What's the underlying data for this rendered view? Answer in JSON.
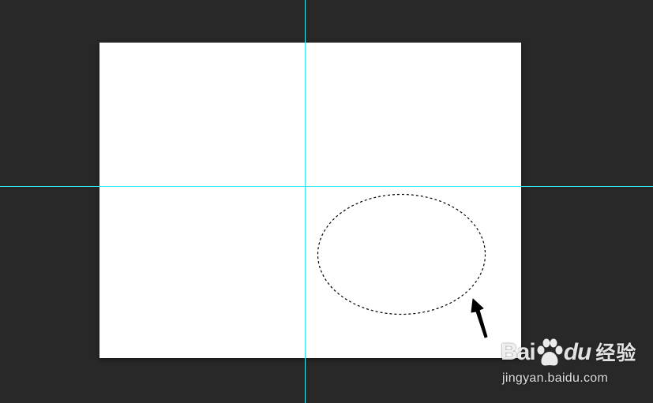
{
  "app": {
    "background_color": "#282828",
    "canvas_color": "#ffffff",
    "guide_color": "#35e8ee"
  },
  "selection": {
    "shape": "ellipse",
    "style": "marching-ants",
    "colors": [
      "#000000",
      "#ffffff"
    ]
  },
  "cursor": {
    "icon": "arrow-cursor-icon",
    "color": "#000000"
  },
  "watermark": {
    "logo_text_left": "Bai",
    "logo_text_right": "du",
    "logo_text_cn": "经验",
    "url": "jingyan.baidu.com",
    "icon": "baidu-paw-icon"
  }
}
